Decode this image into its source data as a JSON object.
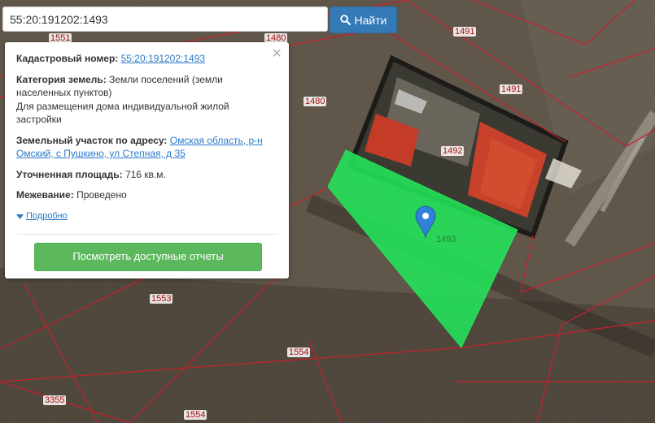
{
  "search": {
    "value": "55:20:191202:1493",
    "button_label": "Найти",
    "button_icon": "search-icon"
  },
  "popup": {
    "cadastral_label": "Кадастровый номер:",
    "cadastral_value": "55:20:191202:1493",
    "category_label": "Категория земель:",
    "category_value_line1": "Земли поселений (земли",
    "category_value_line2": "населенных пунктов)",
    "usage_line1": "Для размещения дома индивидуальной жилой",
    "usage_line2": "застройки",
    "address_label": "Земельный участок по адресу:",
    "address_value_line1": "Омская область, р-н",
    "address_value_line2": "Омский, с Пушкино, ул Степная, д 35",
    "area_label": "Уточненная площадь:",
    "area_value": "716 кв.м.",
    "survey_label": "Межевание:",
    "survey_value": "Проведено",
    "more_label": "Подробно",
    "report_button": "Посмотреть доступные отчеты",
    "close_icon": "×"
  },
  "map": {
    "parcel_labels": [
      "1551",
      "1480",
      "1491",
      "1491",
      "1480",
      "1492",
      "1493",
      "1553",
      "1554",
      "3355",
      "1554"
    ],
    "colors": {
      "highlight": "#22e55a",
      "parcel_border": "#c8202a",
      "marker": "#2f82d8"
    }
  }
}
